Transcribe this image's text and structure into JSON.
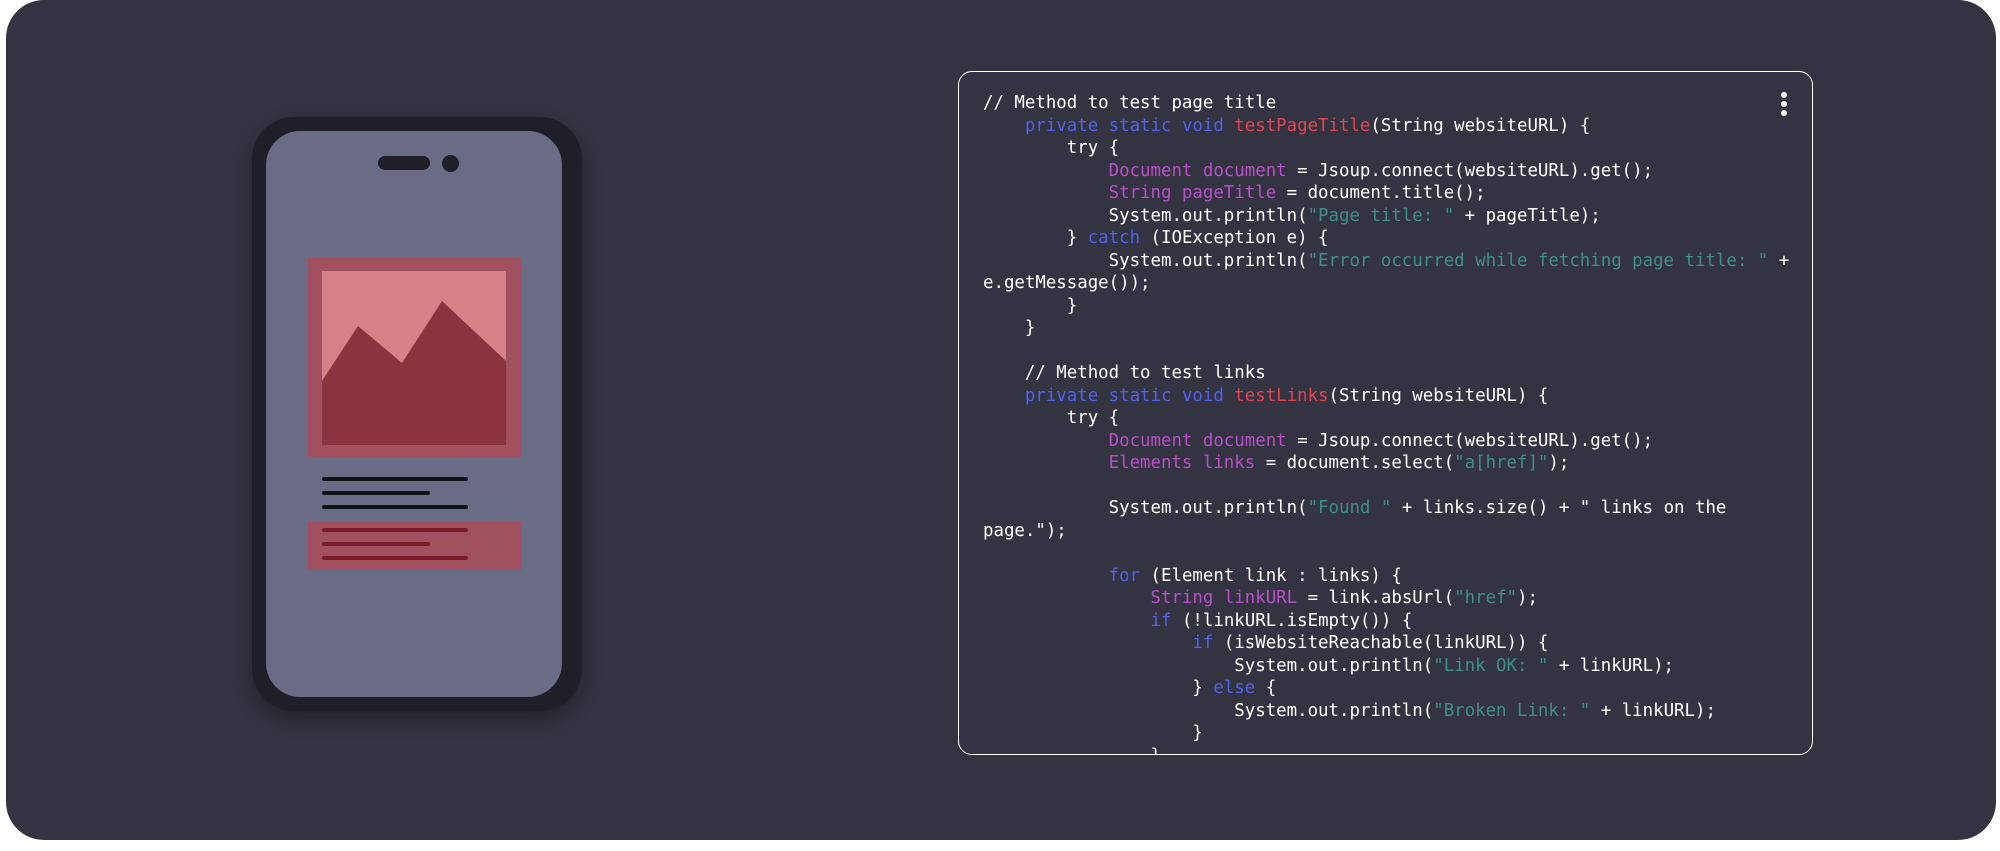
{
  "colors": {
    "background": "#343341",
    "phone_body": "#1f1e29",
    "phone_screen": "#6a6b85",
    "accent_card": "#a0505e",
    "image_sky": "#d68087",
    "image_mountain": "#8b3440",
    "keyword": "#5063e8",
    "function_name": "#e0454f",
    "type_name": "#b84fc9",
    "string": "#3f8f84"
  },
  "phone": {
    "image_icon": "image-placeholder-icon"
  },
  "code_panel": {
    "menu_icon": "vertical-dots-icon",
    "lines": [
      [
        {
          "t": "// Method to test page title",
          "c": ""
        }
      ],
      [
        {
          "t": "    ",
          "c": ""
        },
        {
          "t": "private static void ",
          "c": "kw"
        },
        {
          "t": "testPageTitle",
          "c": "fn"
        },
        {
          "t": "(String websiteURL) {",
          "c": ""
        }
      ],
      [
        {
          "t": "        try {",
          "c": ""
        }
      ],
      [
        {
          "t": "            ",
          "c": ""
        },
        {
          "t": "Document document",
          "c": "ty"
        },
        {
          "t": " = Jsoup.connect(websiteURL).get();",
          "c": ""
        }
      ],
      [
        {
          "t": "            ",
          "c": ""
        },
        {
          "t": "String pageTitle",
          "c": "ty"
        },
        {
          "t": " = document.title();",
          "c": ""
        }
      ],
      [
        {
          "t": "            System.out.println(",
          "c": ""
        },
        {
          "t": "\"Page title: \"",
          "c": "st"
        },
        {
          "t": " + pageTitle);",
          "c": ""
        }
      ],
      [
        {
          "t": "        } ",
          "c": ""
        },
        {
          "t": "catch",
          "c": "kw"
        },
        {
          "t": " (IOException e) {",
          "c": ""
        }
      ],
      [
        {
          "t": "            System.out.println(",
          "c": ""
        },
        {
          "t": "\"Error occurred while fetching page title: \"",
          "c": "st"
        },
        {
          "t": " +",
          "c": ""
        }
      ],
      [
        {
          "t": "e.getMessage());",
          "c": ""
        }
      ],
      [
        {
          "t": "        }",
          "c": ""
        }
      ],
      [
        {
          "t": "    }",
          "c": ""
        }
      ],
      [
        {
          "t": "",
          "c": ""
        }
      ],
      [
        {
          "t": "    // Method to test links",
          "c": ""
        }
      ],
      [
        {
          "t": "    ",
          "c": ""
        },
        {
          "t": "private static void ",
          "c": "kw"
        },
        {
          "t": "testLinks",
          "c": "fn"
        },
        {
          "t": "(String websiteURL) {",
          "c": ""
        }
      ],
      [
        {
          "t": "        try {",
          "c": ""
        }
      ],
      [
        {
          "t": "            ",
          "c": ""
        },
        {
          "t": "Document document",
          "c": "ty"
        },
        {
          "t": " = Jsoup.connect(websiteURL).get();",
          "c": ""
        }
      ],
      [
        {
          "t": "            ",
          "c": ""
        },
        {
          "t": "Elements links",
          "c": "ty"
        },
        {
          "t": " = document.select(",
          "c": ""
        },
        {
          "t": "\"a[href]\"",
          "c": "st"
        },
        {
          "t": ");",
          "c": ""
        }
      ],
      [
        {
          "t": "",
          "c": ""
        }
      ],
      [
        {
          "t": "            System.out.println(",
          "c": ""
        },
        {
          "t": "\"Found \"",
          "c": "st"
        },
        {
          "t": " + links.size() + \" links on the",
          "c": ""
        }
      ],
      [
        {
          "t": "page.\");",
          "c": ""
        }
      ],
      [
        {
          "t": "",
          "c": ""
        }
      ],
      [
        {
          "t": "            ",
          "c": ""
        },
        {
          "t": "for",
          "c": "kw"
        },
        {
          "t": " (Element link : links) {",
          "c": ""
        }
      ],
      [
        {
          "t": "                ",
          "c": ""
        },
        {
          "t": "String linkURL",
          "c": "ty"
        },
        {
          "t": " = link.absUrl(",
          "c": ""
        },
        {
          "t": "\"href\"",
          "c": "st"
        },
        {
          "t": ");",
          "c": ""
        }
      ],
      [
        {
          "t": "                ",
          "c": ""
        },
        {
          "t": "if",
          "c": "kw"
        },
        {
          "t": " (!linkURL.isEmpty()) {",
          "c": ""
        }
      ],
      [
        {
          "t": "                    ",
          "c": ""
        },
        {
          "t": "if",
          "c": "kw"
        },
        {
          "t": " (isWebsiteReachable(linkURL)) {",
          "c": ""
        }
      ],
      [
        {
          "t": "                        System.out.println(",
          "c": ""
        },
        {
          "t": "\"Link OK: \"",
          "c": "st"
        },
        {
          "t": " + linkURL);",
          "c": ""
        }
      ],
      [
        {
          "t": "                    } ",
          "c": ""
        },
        {
          "t": "else",
          "c": "kw"
        },
        {
          "t": " {",
          "c": ""
        }
      ],
      [
        {
          "t": "                        System.out.println(",
          "c": ""
        },
        {
          "t": "\"Broken Link: \"",
          "c": "st"
        },
        {
          "t": " + linkURL);",
          "c": ""
        }
      ],
      [
        {
          "t": "                    }",
          "c": ""
        }
      ],
      [
        {
          "t": "                }",
          "c": ""
        }
      ]
    ]
  }
}
